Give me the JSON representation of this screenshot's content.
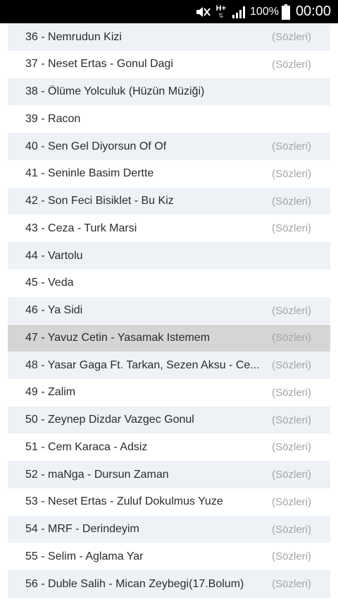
{
  "status_bar": {
    "network": "H+",
    "battery_percent": "100%",
    "time": "00:00",
    "icons": [
      "mute-icon",
      "network-arrows-icon",
      "signal-icon",
      "battery-icon"
    ]
  },
  "songs": [
    {
      "title": "36 - Nemrudun Kizi",
      "lyrics": "(Sözleri)"
    },
    {
      "title": "37 - Neset Ertas - Gonul Dagi",
      "lyrics": "(Sözleri)"
    },
    {
      "title": "38 - Ölüme Yolculuk (Hüzün Müziği)",
      "lyrics": ""
    },
    {
      "title": "39 - Racon",
      "lyrics": ""
    },
    {
      "title": "40 - Sen Gel Diyorsun Of Of",
      "lyrics": "(Sözleri)"
    },
    {
      "title": "41 - Seninle Basim Dertte",
      "lyrics": "(Sözleri)"
    },
    {
      "title": "42 - Son Feci Bisiklet - Bu Kiz",
      "lyrics": "(Sözleri)"
    },
    {
      "title": "43 - Ceza - Turk Marsi",
      "lyrics": "(Sözleri)"
    },
    {
      "title": "44 - Vartolu",
      "lyrics": ""
    },
    {
      "title": "45 - Veda",
      "lyrics": ""
    },
    {
      "title": "46 - Ya Sidi",
      "lyrics": "(Sözleri)"
    },
    {
      "title": "47 - Yavuz Cetin - Yasamak Istemem",
      "lyrics": "(Sözleri)",
      "selected": true
    },
    {
      "title": "48 - Yasar Gaga Ft. Tarkan, Sezen Aksu - Ce...",
      "lyrics": "(Sözleri)"
    },
    {
      "title": "49 - Zalim",
      "lyrics": "(Sözleri)"
    },
    {
      "title": "50 - Zeynep Dizdar Vazgec Gonul",
      "lyrics": "(Sözleri)"
    },
    {
      "title": "51 - Cem Karaca - Adsiz",
      "lyrics": "(Sözleri)"
    },
    {
      "title": "52 - maNga - Dursun Zaman",
      "lyrics": "(Sözleri)"
    },
    {
      "title": "53 - Neset Ertas - Zuluf Dokulmus Yuze",
      "lyrics": "(Sözleri)"
    },
    {
      "title": "54 - MRF - Derindeyim",
      "lyrics": "(Sözleri)"
    },
    {
      "title": "55 - Selim - Aglama Yar",
      "lyrics": "(Sözleri)"
    },
    {
      "title": "56 - Duble Salih - Mican Zeybegi(17.Bolum)",
      "lyrics": "(Sözleri)"
    }
  ]
}
